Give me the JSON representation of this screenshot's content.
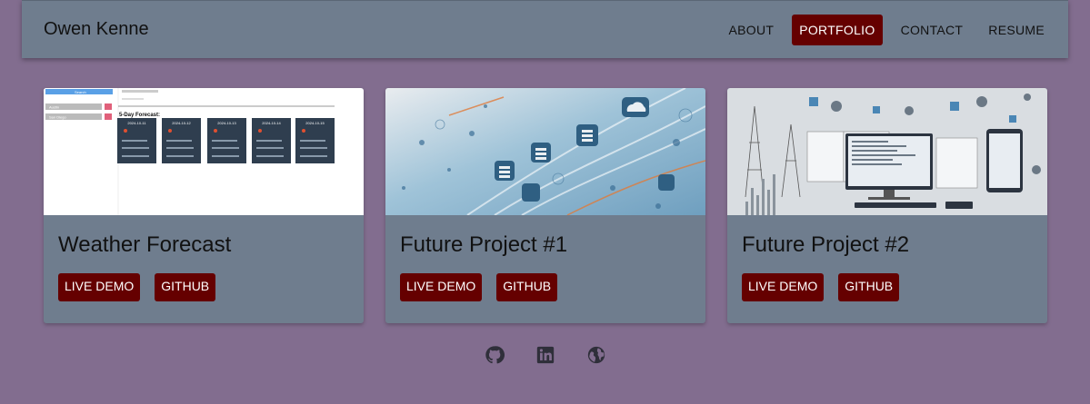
{
  "header": {
    "brand": "Owen Kenne",
    "nav": [
      {
        "label": "ABOUT",
        "active": false
      },
      {
        "label": "PORTFOLIO",
        "active": true
      },
      {
        "label": "CONTACT",
        "active": false
      },
      {
        "label": "RESUME",
        "active": false
      }
    ]
  },
  "projects": [
    {
      "title": "Weather Forecast",
      "demo_label": "LIVE DEMO",
      "github_label": "GITHUB"
    },
    {
      "title": "Future Project #1",
      "demo_label": "LIVE DEMO",
      "github_label": "GITHUB"
    },
    {
      "title": "Future Project #2",
      "demo_label": "LIVE DEMO",
      "github_label": "GITHUB"
    }
  ],
  "weather_preview": {
    "section_title": "5-Day Forecast:",
    "search_button": "Search",
    "history": [
      "Austin",
      "San Diego"
    ],
    "days": [
      "2024-10-11",
      "2024-10-12",
      "2024-10-13",
      "2024-10-14",
      "2024-10-15"
    ]
  },
  "footer": {
    "icons": [
      "github-icon",
      "linkedin-icon",
      "globe-icon"
    ]
  },
  "colors": {
    "background": "#826d8f",
    "navbar": "#6f7d8e",
    "accent": "#650000"
  }
}
